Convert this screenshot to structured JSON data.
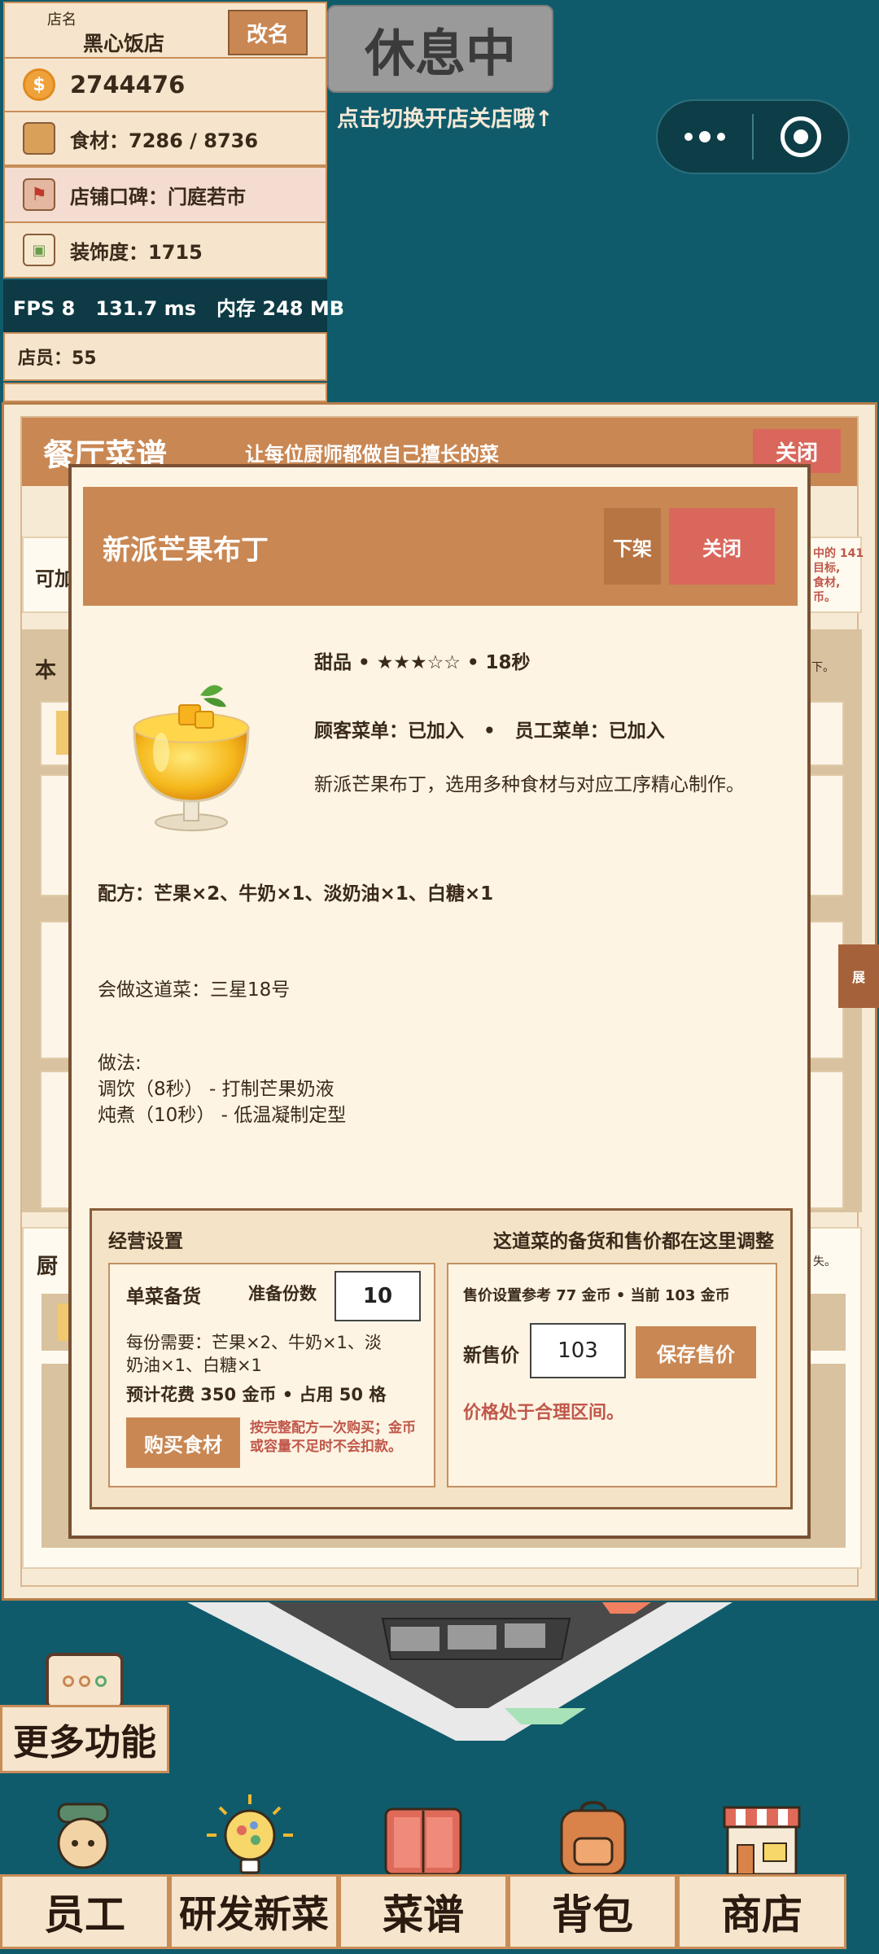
{
  "hud": {
    "shop_name_label": "店名",
    "shop_name": "黑心饭店",
    "rename_label": "改名",
    "coins": "2744476",
    "ingredients": "食材：7286 / 8736",
    "reputation": "店铺口碑：门庭若市",
    "decoration": "装饰度：1715",
    "fps": "FPS 8   131.7 ms   内存 248 MB",
    "staff": "店员：55"
  },
  "status": {
    "badge": "休息中",
    "tip": "点击切换开店关店哦↑"
  },
  "panel": {
    "title": "餐厅菜谱",
    "subtitle": "让每位厨师都做自己擅长的菜",
    "close_label": "关闭",
    "side_tab": "展",
    "bg_fragment_1": "可加",
    "bg_fragment_2": "本",
    "bg_fragment_3": "厨",
    "bg_fragment_right_1": "中的 141\n目标,\n食材,\n币。",
    "bg_fragment_right_2": "下。",
    "bg_fragment_right_3": "失。"
  },
  "dish": {
    "name": "新派芒果布丁",
    "unlist_label": "下架",
    "close_label": "关闭",
    "meta": "甜品 • ★★★☆☆ • 18秒",
    "menus": "顾客菜单：已加入   •   员工菜单：已加入",
    "desc": "新派芒果布丁，选用多种食材与对应工序精心制作。",
    "recipe": "配方：芒果×2、牛奶×1、淡奶油×1、白糖×1",
    "cooks": "会做这道菜：三星18号",
    "method_title": "做法:",
    "step1": "调饮（8秒） - 打制芒果奶液",
    "step2": "炖煮（10秒） - 低温凝制定型"
  },
  "business": {
    "title": "经营设置",
    "hint": "这道菜的备货和售价都在这里调整",
    "stock_title": "单菜备货",
    "stock_qty_label": "准备份数",
    "stock_qty": "10",
    "need_line1": "每份需要：芒果×2、牛奶×1、淡",
    "need_line2": "奶油×1、白糖×1",
    "cost": "预计花费 350 金币 • 占用 50 格",
    "buy_label": "购买食材",
    "buy_note": "按完整配方一次购买；金币或容量不足时不会扣款。",
    "price_ref": "售价设置参考 77 金币 • 当前 103 金币",
    "new_price_label": "新售价",
    "new_price": "103",
    "save_label": "保存售价",
    "price_status": "价格处于合理区间。"
  },
  "bottom": {
    "more": "更多功能",
    "nav": [
      "员工",
      "研发新菜",
      "菜谱",
      "背包",
      "商店"
    ]
  },
  "colors": {
    "background": "#0f5b6b",
    "accent": "#c98753",
    "close_red": "#d9675c",
    "panel_bg": "#f7ead4"
  }
}
